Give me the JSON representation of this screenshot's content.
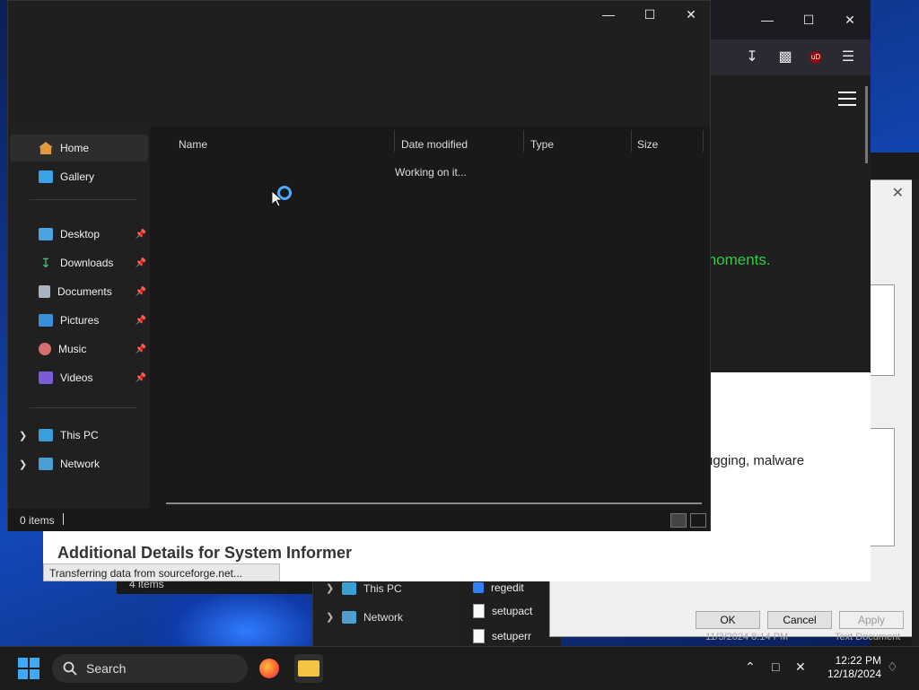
{
  "explorer": {
    "nav": {
      "home": "Home",
      "gallery": "Gallery",
      "desktop": "Desktop",
      "downloads": "Downloads",
      "documents": "Documents",
      "pictures": "Pictures",
      "music": "Music",
      "videos": "Videos",
      "this_pc": "This PC",
      "network": "Network"
    },
    "columns": {
      "name": "Name",
      "date_modified": "Date modified",
      "type": "Type",
      "size": "Size"
    },
    "loading_text": "Working on it...",
    "status_items": "0 items"
  },
  "browser": {
    "green_text": "moments.",
    "body_text": "ugging, malware",
    "banner_title": "Additional Details for System Informer",
    "status_tip": "Transferring data from sourceforge.net...",
    "ublock_label": "uD"
  },
  "dialog": {
    "ok": "OK",
    "cancel": "Cancel",
    "apply": "Apply",
    "ghost_date": "11/3/2024 8:14 PM",
    "ghost_type": "Text Document"
  },
  "bg_explorer": {
    "status_items": "4 items",
    "nav_this_pc": "This PC",
    "nav_network": "Network",
    "files": [
      "regedit",
      "setupact",
      "setuperr"
    ]
  },
  "taskbar": {
    "search_placeholder": "Search",
    "time": "12:22 PM",
    "date": "12/18/2024"
  }
}
